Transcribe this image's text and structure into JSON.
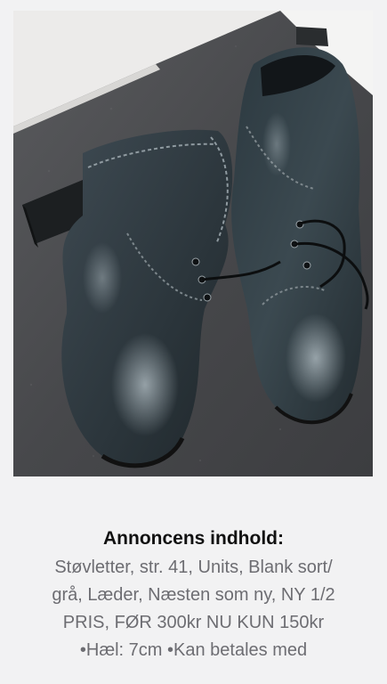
{
  "listing": {
    "photo_alt": "",
    "description_heading": "Annoncens indhold:",
    "description_lines": [
      "Støvletter, str. 41, Units, Blank sort/",
      "grå, Læder, Næsten som ny, NY 1/2",
      "PRIS, FØR 300kr NU KUN 150kr",
      "•Hæl: 7cm •Kan betales med"
    ]
  },
  "colors": {
    "background": "#f2f2f3",
    "heading_text": "#111111",
    "body_text": "#6d6d72"
  }
}
